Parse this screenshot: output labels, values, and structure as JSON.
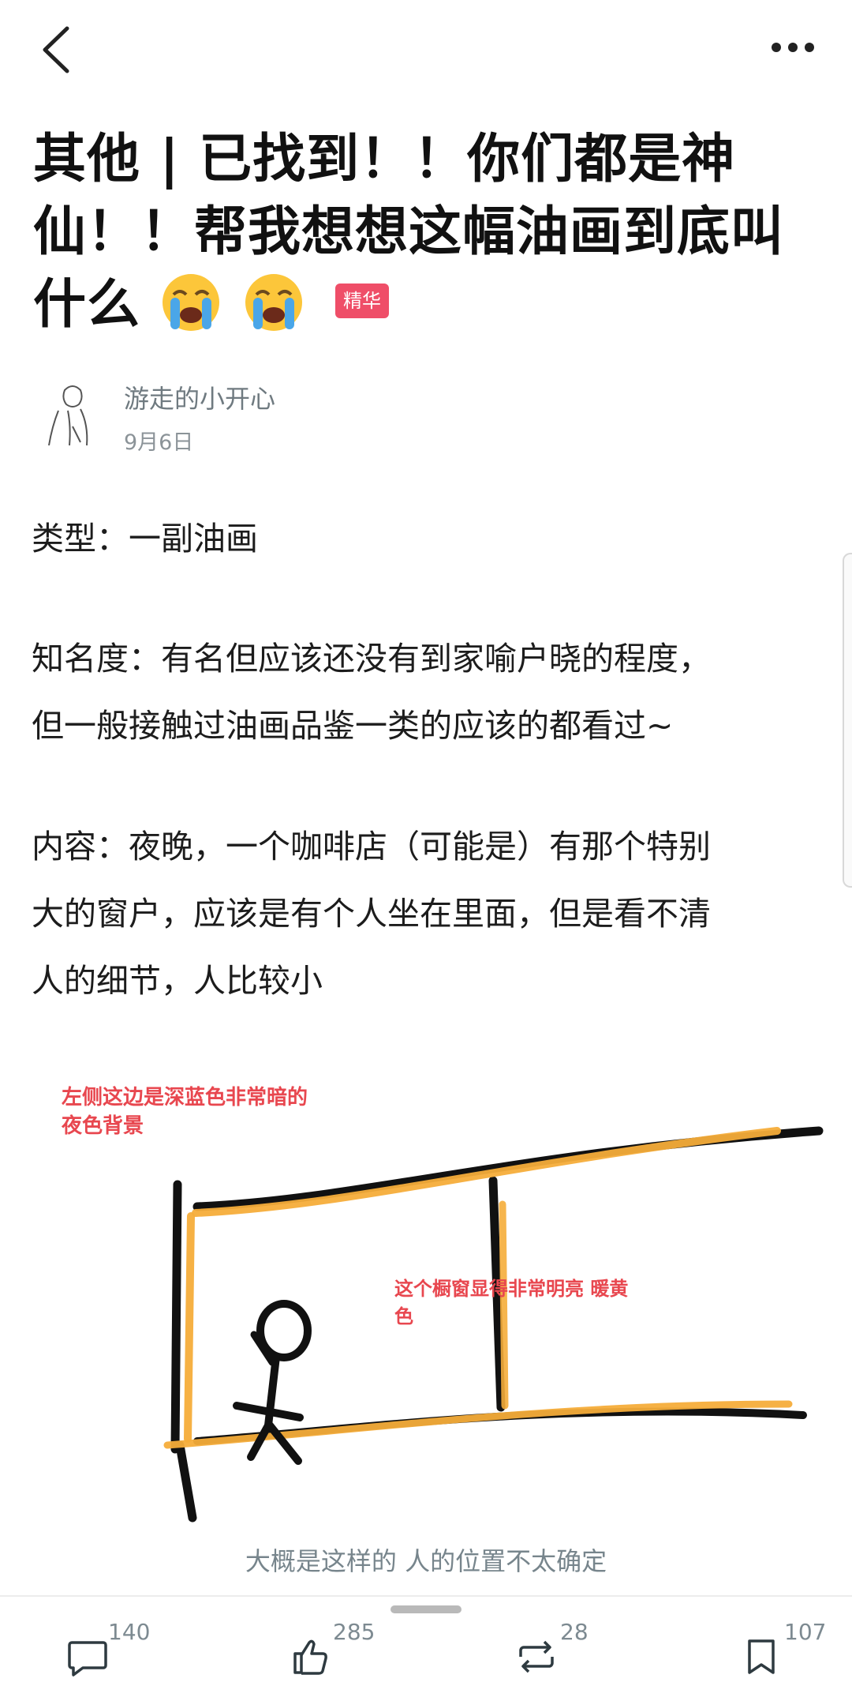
{
  "header": {
    "back_icon": "chevron-left-icon",
    "more_icon": "more-dots-icon"
  },
  "post": {
    "title_line1": "其他 | 已找到！！你们都是神",
    "title_line2": "仙！！帮我想想这幅油画到底叫",
    "title_line3": "什么",
    "emoji": "loudly-crying-face-icon",
    "badge": "精华",
    "badge_color": "#ef4e68"
  },
  "author": {
    "name": "游走的小开心",
    "date": "9月6日"
  },
  "body": {
    "type_line": "类型：一副油画",
    "fame_line1": "知名度：有名但应该还没有到家喻户晓的程度，",
    "fame_line2": "但一般接触过油画品鉴一类的应该的都看过~",
    "content_line1": "内容：夜晚，一个咖啡店（可能是）有那个特别",
    "content_line2": "大的窗户，应该是有个人坐在里面，但是看不清",
    "content_line3": "人的细节，人比较小"
  },
  "image": {
    "note_left_line1": "左侧这边是深蓝色非常暗的",
    "note_left_line2": "夜色背景",
    "note_window_line1": "这个橱窗显得非常明亮 暖黄",
    "note_window_line2": "色",
    "caption": "大概是这样的 人的位置不太确定",
    "note_color": "#e8474f",
    "stroke_color": "#111111",
    "highlight_color": "#f5ad3a"
  },
  "actions": {
    "comment_count": "140",
    "like_count": "285",
    "repost_count": "28",
    "bookmark_count": "107"
  }
}
